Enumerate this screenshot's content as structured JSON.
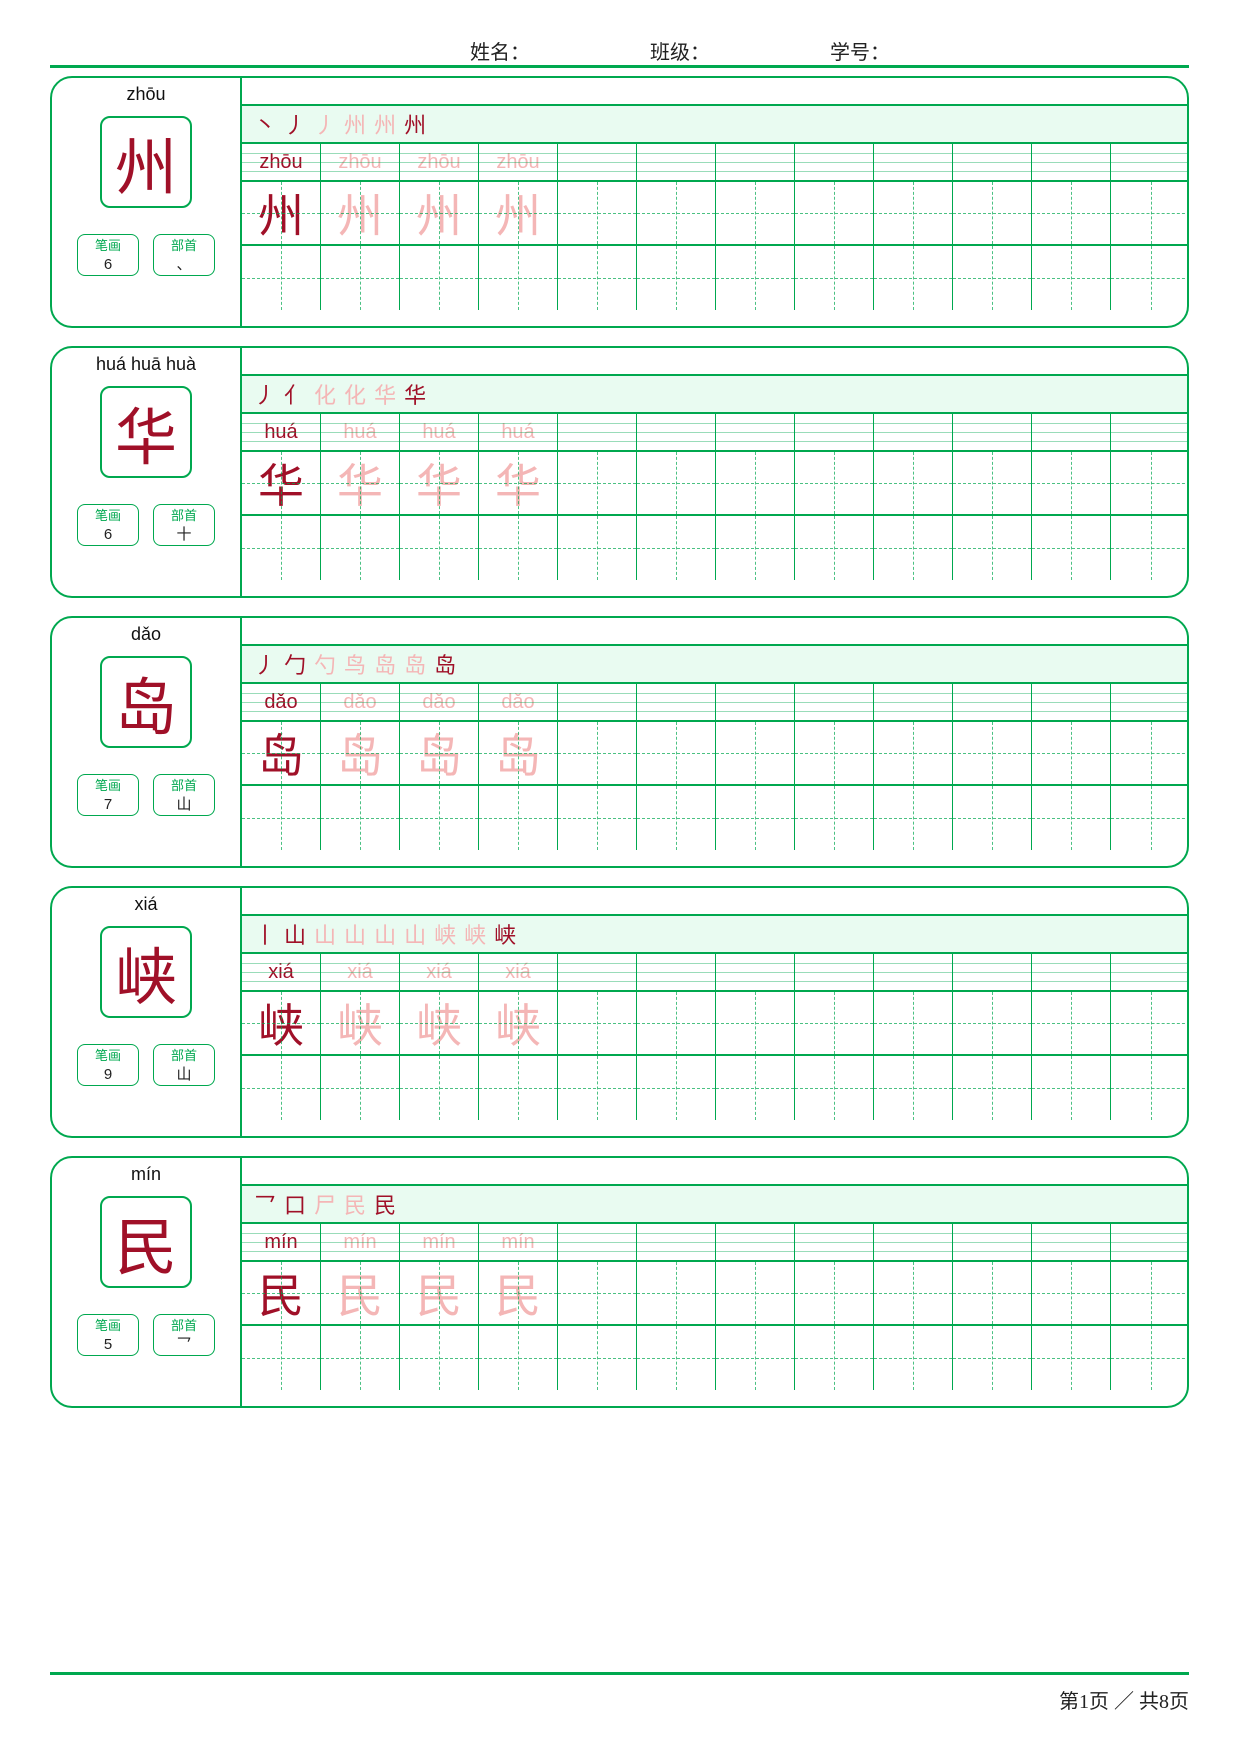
{
  "header": {
    "name_label": "姓名：",
    "class_label": "班级：",
    "id_label": "学号："
  },
  "meta_labels": {
    "strokes": "笔画",
    "radical": "部首"
  },
  "grid": {
    "columns": 12
  },
  "entries": [
    {
      "pinyin_top": "zhōu",
      "char": "州",
      "stroke_count": "6",
      "radical": "、",
      "stroke_steps": [
        "丶",
        "丿",
        "丿",
        "州",
        "州",
        "州"
      ],
      "pinyin_row": [
        "zhōu",
        "zhōu",
        "zhōu",
        "zhōu"
      ],
      "char_row": [
        "州",
        "州",
        "州",
        "州"
      ]
    },
    {
      "pinyin_top": "huá  huā  huà",
      "char": "华",
      "stroke_count": "6",
      "radical": "十",
      "stroke_steps": [
        "丿",
        "亻",
        "化",
        "化",
        "华",
        "华"
      ],
      "pinyin_row": [
        "huá",
        "huá",
        "huá",
        "huá"
      ],
      "char_row": [
        "华",
        "华",
        "华",
        "华"
      ]
    },
    {
      "pinyin_top": "dǎo",
      "char": "岛",
      "stroke_count": "7",
      "radical": "山",
      "stroke_steps": [
        "丿",
        "勹",
        "勺",
        "鸟",
        "岛",
        "岛",
        "岛"
      ],
      "pinyin_row": [
        "dǎo",
        "dǎo",
        "dǎo",
        "dǎo"
      ],
      "char_row": [
        "岛",
        "岛",
        "岛",
        "岛"
      ]
    },
    {
      "pinyin_top": "xiá",
      "char": "峡",
      "stroke_count": "9",
      "radical": "山",
      "stroke_steps": [
        "丨",
        "山",
        "山",
        "山",
        "山",
        "山",
        "峡",
        "峡",
        "峡"
      ],
      "pinyin_row": [
        "xiá",
        "xiá",
        "xiá",
        "xiá"
      ],
      "char_row": [
        "峡",
        "峡",
        "峡",
        "峡"
      ]
    },
    {
      "pinyin_top": "mín",
      "char": "民",
      "stroke_count": "5",
      "radical": "乛",
      "stroke_steps": [
        "乛",
        "口",
        "尸",
        "民",
        "民"
      ],
      "pinyin_row": [
        "mín",
        "mín",
        "mín",
        "mín"
      ],
      "char_row": [
        "民",
        "民",
        "民",
        "民"
      ]
    }
  ],
  "footer": {
    "page": "第1页",
    "sep": " ／ ",
    "total": "共8页"
  }
}
